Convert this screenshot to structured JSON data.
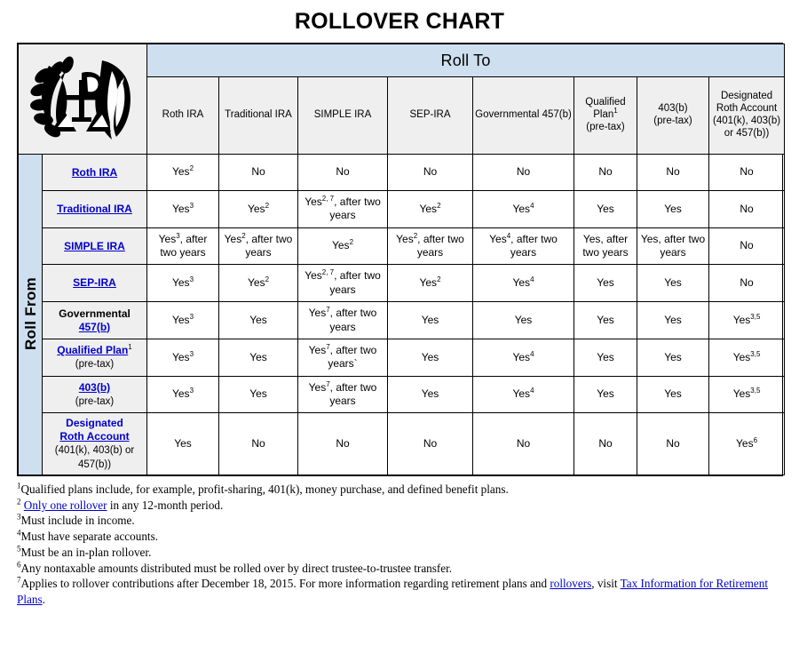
{
  "title": "ROLLOVER CHART",
  "logo": {
    "icon": "irs-eagle-scales-logo",
    "alt": "IRS logo"
  },
  "axes": {
    "roll_to": "Roll To",
    "roll_from": "Roll From"
  },
  "colors": {
    "header_blue": "#cedfef",
    "cell_gray": "#efefef",
    "link_blue": "#0000cc",
    "border": "#000000"
  },
  "columns": [
    {
      "id": "roth_ira",
      "label": "Roth IRA",
      "sub": ""
    },
    {
      "id": "traditional_ira",
      "label": "Traditional IRA",
      "sub": ""
    },
    {
      "id": "simple_ira",
      "label": "SIMPLE IRA",
      "sub": ""
    },
    {
      "id": "sep_ira",
      "label": "SEP-IRA",
      "sub": ""
    },
    {
      "id": "governmental_457b",
      "label": "Governmental 457(b)",
      "sub": ""
    },
    {
      "id": "qualified_plan",
      "label": "Qualified Plan",
      "sup": "1",
      "sub": "(pre-tax)"
    },
    {
      "id": "403b",
      "label": "403(b)",
      "sub": "(pre-tax)"
    },
    {
      "id": "designated_roth",
      "label": "Designated Roth Account",
      "sub": "(401(k), 403(b) or 457(b))"
    }
  ],
  "rows": [
    {
      "id": "roth_ira",
      "label_link": "Roth IRA",
      "label_sup": "",
      "label_sub": "",
      "cells": [
        {
          "text": "Yes",
          "sup": "2"
        },
        {
          "text": "No",
          "sup": ""
        },
        {
          "text": "No",
          "sup": ""
        },
        {
          "text": "No",
          "sup": ""
        },
        {
          "text": "No",
          "sup": ""
        },
        {
          "text": "No",
          "sup": ""
        },
        {
          "text": "No",
          "sup": ""
        },
        {
          "text": "No",
          "sup": ""
        }
      ]
    },
    {
      "id": "traditional_ira",
      "label_link": "Traditional IRA",
      "label_sup": "",
      "label_sub": "",
      "cells": [
        {
          "text": "Yes",
          "sup": "3"
        },
        {
          "text": "Yes",
          "sup": "2"
        },
        {
          "text": "Yes",
          "sup": "2, 7",
          "tail": ", after two years"
        },
        {
          "text": "Yes",
          "sup": "2"
        },
        {
          "text": "Yes",
          "sup": "4"
        },
        {
          "text": "Yes",
          "sup": ""
        },
        {
          "text": "Yes",
          "sup": ""
        },
        {
          "text": "No",
          "sup": ""
        }
      ]
    },
    {
      "id": "simple_ira",
      "label_link": "SIMPLE IRA",
      "label_sup": "",
      "label_sub": "",
      "cells": [
        {
          "text": "Yes",
          "sup": "3",
          "tail": ", after two years"
        },
        {
          "text": "Yes",
          "sup": "2",
          "tail": ", after two years"
        },
        {
          "text": "Yes",
          "sup": "2"
        },
        {
          "text": "Yes",
          "sup": "2",
          "tail": ", after two years"
        },
        {
          "text": "Yes",
          "sup": "4",
          "tail": ", after two years"
        },
        {
          "text": "Yes, after two years",
          "sup": ""
        },
        {
          "text": "Yes, after two years",
          "sup": ""
        },
        {
          "text": "No",
          "sup": ""
        }
      ]
    },
    {
      "id": "sep_ira",
      "label_link": "SEP-IRA",
      "label_sup": "",
      "label_sub": "",
      "cells": [
        {
          "text": "Yes",
          "sup": "3"
        },
        {
          "text": "Yes",
          "sup": "2"
        },
        {
          "text": "Yes",
          "sup": "2, 7",
          "tail": ", after two years"
        },
        {
          "text": "Yes",
          "sup": "2"
        },
        {
          "text": "Yes",
          "sup": "4"
        },
        {
          "text": "Yes",
          "sup": ""
        },
        {
          "text": "Yes",
          "sup": ""
        },
        {
          "text": "No",
          "sup": ""
        }
      ]
    },
    {
      "id": "governmental_457b",
      "label_black": "Governmental",
      "label_link": "457(b)",
      "label_sup": "",
      "label_sub": "",
      "cells": [
        {
          "text": "Yes",
          "sup": "3"
        },
        {
          "text": "Yes",
          "sup": ""
        },
        {
          "text": "Yes",
          "sup": "7",
          "tail": ", after two years"
        },
        {
          "text": "Yes",
          "sup": ""
        },
        {
          "text": "Yes",
          "sup": ""
        },
        {
          "text": "Yes",
          "sup": ""
        },
        {
          "text": "Yes",
          "sup": ""
        },
        {
          "text": "Yes",
          "sup": "3,5"
        }
      ]
    },
    {
      "id": "qualified_plan",
      "label_link": "Qualified Plan",
      "label_sup": "1",
      "label_sub": "(pre-tax)",
      "cells": [
        {
          "text": "Yes",
          "sup": "3"
        },
        {
          "text": "Yes",
          "sup": ""
        },
        {
          "text": "Yes",
          "sup": "7",
          "tail": ", after two years`"
        },
        {
          "text": "Yes",
          "sup": ""
        },
        {
          "text": "Yes",
          "sup": "4"
        },
        {
          "text": "Yes",
          "sup": ""
        },
        {
          "text": "Yes",
          "sup": ""
        },
        {
          "text": "Yes",
          "sup": "3,5"
        }
      ]
    },
    {
      "id": "403b",
      "label_link": "403(b)",
      "label_sup": "",
      "label_sub": "(pre-tax)",
      "cells": [
        {
          "text": "Yes",
          "sup": "3"
        },
        {
          "text": "Yes",
          "sup": ""
        },
        {
          "text": "Yes",
          "sup": "7",
          "tail": ", after two years"
        },
        {
          "text": "Yes",
          "sup": ""
        },
        {
          "text": "Yes",
          "sup": "4"
        },
        {
          "text": "Yes",
          "sup": ""
        },
        {
          "text": "Yes",
          "sup": ""
        },
        {
          "text": "Yes",
          "sup": "3,5"
        }
      ]
    },
    {
      "id": "designated_roth_account",
      "label_plain_blue": "Designated",
      "label_link": "Roth Account",
      "label_sup": "",
      "label_sub": "(401(k), 403(b) or 457(b))",
      "cells": [
        {
          "text": "Yes",
          "sup": ""
        },
        {
          "text": "No",
          "sup": ""
        },
        {
          "text": "No",
          "sup": ""
        },
        {
          "text": "No",
          "sup": ""
        },
        {
          "text": "No",
          "sup": ""
        },
        {
          "text": "No",
          "sup": ""
        },
        {
          "text": "No",
          "sup": ""
        },
        {
          "text": "Yes",
          "sup": "6"
        }
      ]
    }
  ],
  "footnotes": [
    {
      "num": "1",
      "text": "Qualified plans include, for example, profit-sharing, 401(k), money purchase, and defined benefit plans."
    },
    {
      "num": "2",
      "pre": " ",
      "link": "Only one rollover",
      "post": " in any 12-month period."
    },
    {
      "num": "3",
      "text": "Must include in income."
    },
    {
      "num": "4",
      "text": "Must have separate accounts."
    },
    {
      "num": "5",
      "text": "Must be an in-plan rollover."
    },
    {
      "num": "6",
      "text": "Any nontaxable amounts distributed must be rolled over by direct trustee-to-trustee transfer."
    },
    {
      "num": "7",
      "pre": "Applies to rollover contributions after December 18, 2015. For more information regarding retirement plans and ",
      "link": "rollovers",
      "mid": ", visit ",
      "link2": "Tax Information for Retirement Plans",
      "post": "."
    }
  ]
}
